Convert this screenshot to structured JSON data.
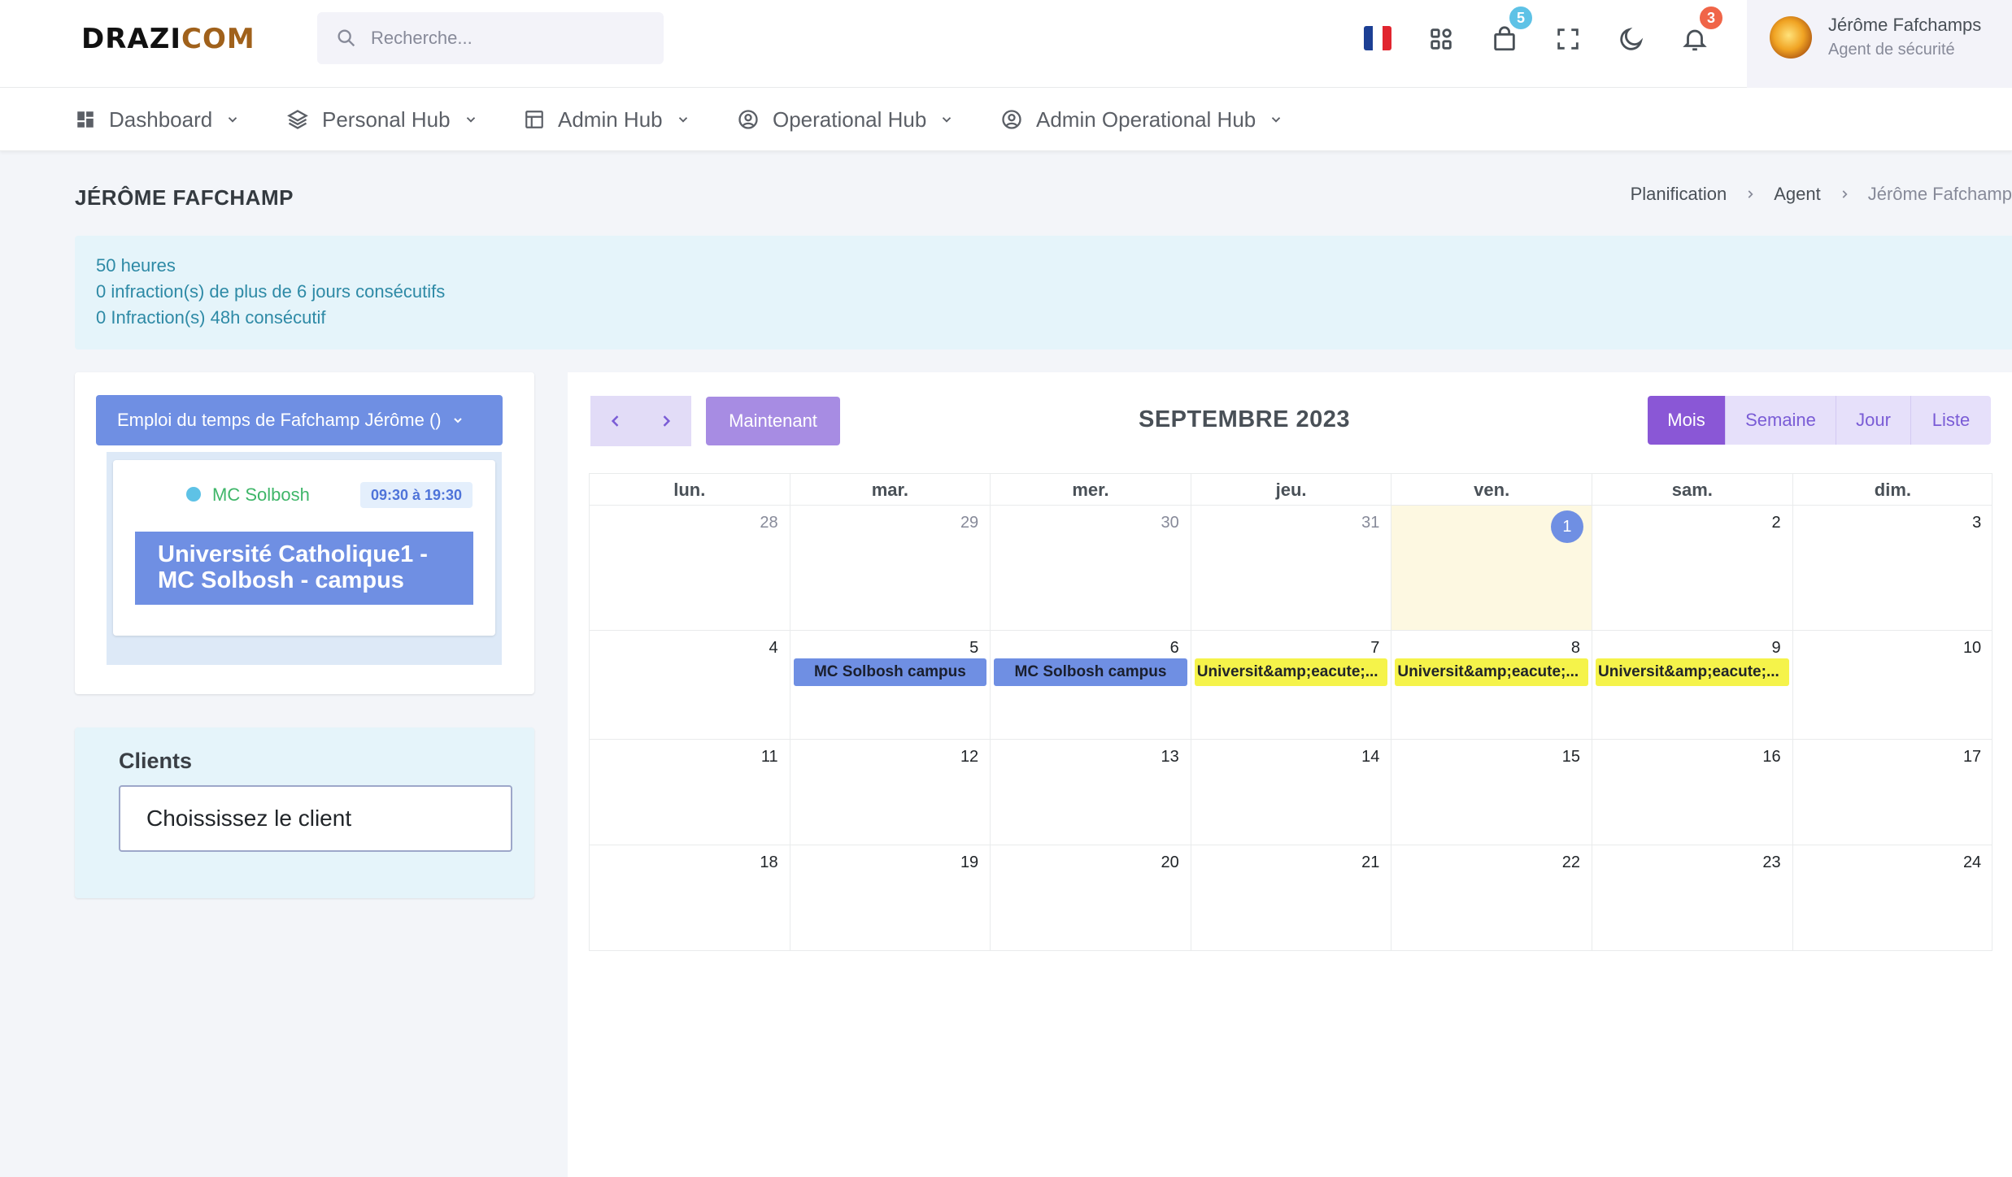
{
  "header": {
    "logo": {
      "part1": "DRAZI",
      "part2": "COM"
    },
    "search_placeholder": "Recherche...",
    "badges": {
      "cart": "5",
      "notifications": "3"
    },
    "user": {
      "name": "Jérôme Fafchamps",
      "role": "Agent de sécurité"
    },
    "colors": {
      "badge_info": "#5ec2e6",
      "badge_danger": "#f06548"
    },
    "icons": [
      "france-flag-icon",
      "apps-grid-icon",
      "shopping-bag-icon",
      "fullscreen-icon",
      "dark-mode-moon-icon",
      "bell-icon"
    ]
  },
  "nav": {
    "items": [
      {
        "label": "Dashboard",
        "icon": "dashboard-icon"
      },
      {
        "label": "Personal Hub",
        "icon": "layers-icon"
      },
      {
        "label": "Admin Hub",
        "icon": "layout-icon"
      },
      {
        "label": "Operational Hub",
        "icon": "user-circle-icon"
      },
      {
        "label": "Admin Operational Hub",
        "icon": "user-circle-icon"
      }
    ]
  },
  "page": {
    "title": "JÉRÔME FAFCHAMP",
    "breadcrumb": [
      "Planification",
      "Agent",
      "Jérôme Fafchamp"
    ]
  },
  "alert": {
    "lines": [
      "50 heures",
      "0 infraction(s) de plus de 6 jours consécutifs",
      "0 Infraction(s) 48h consécutif"
    ]
  },
  "schedule": {
    "button_label": "Emploi du temps de Fafchamp Jérôme ()",
    "site_name": "MC Solbosh",
    "time_range": "09:30 à 19:30",
    "event_title": "Université Catholique1 - MC Solbosh - campus"
  },
  "clients": {
    "title": "Clients",
    "select_value": "Choississez le client"
  },
  "calendar": {
    "now_label": "Maintenant",
    "title": "SEPTEMBRE 2023",
    "views": [
      {
        "label": "Mois",
        "active": true
      },
      {
        "label": "Semaine",
        "active": false
      },
      {
        "label": "Jour",
        "active": false
      },
      {
        "label": "Liste",
        "active": false
      }
    ],
    "weekdays": [
      "lun.",
      "mar.",
      "mer.",
      "jeu.",
      "ven.",
      "sam.",
      "dim."
    ],
    "weeks": [
      [
        "28",
        "29",
        "30",
        "31",
        "1",
        "2",
        "3"
      ],
      [
        "4",
        "5",
        "6",
        "7",
        "8",
        "9",
        "10"
      ],
      [
        "11",
        "12",
        "13",
        "14",
        "15",
        "16",
        "17"
      ],
      [
        "18",
        "19",
        "20",
        "21",
        "22",
        "23",
        "24"
      ]
    ],
    "today": "1",
    "events": {
      "mc_tue": "MC Solbosh campus",
      "mc_wed": "MC Solbosh campus",
      "univ_thu": "Universit&amp;eacute;...",
      "univ_fri": "Universit&amp;eacute;...",
      "univ_sat": "Universit&amp;eacute;..."
    },
    "colors": {
      "blue_event": "#6f8fe3",
      "yellow_event": "#f5f34a",
      "today_bg": "#fdf8e1"
    }
  }
}
